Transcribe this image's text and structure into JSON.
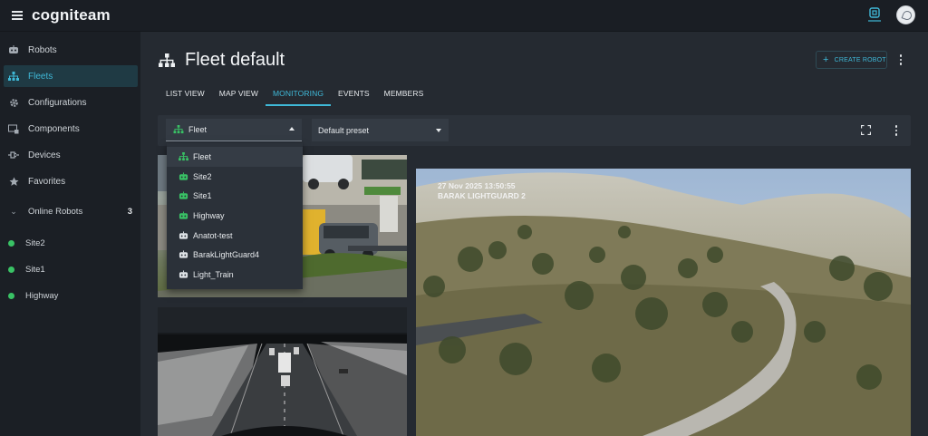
{
  "app": {
    "title": "cogniteam",
    "accent_color": "#3fb9d8",
    "online_color": "#39c265"
  },
  "topbar": {
    "menu_icon": "hamburger-icon",
    "right_icon": "robot-status-icon",
    "avatar_icon": "user-avatar"
  },
  "sidebar": {
    "items": [
      {
        "label": "Robots",
        "icon": "robot-icon"
      },
      {
        "label": "Fleets",
        "icon": "fleet-icon",
        "active": true
      },
      {
        "label": "Configurations",
        "icon": "gear-icon"
      },
      {
        "label": "Components",
        "icon": "components-icon"
      },
      {
        "label": "Devices",
        "icon": "plug-icon"
      },
      {
        "label": "Favorites",
        "icon": "star-icon"
      }
    ],
    "online_header": {
      "label": "Online Robots",
      "count": "3"
    },
    "online_robots": [
      {
        "label": "Site2"
      },
      {
        "label": "Site1"
      },
      {
        "label": "Highway"
      }
    ]
  },
  "page": {
    "title": "Fleet default",
    "create_button": "CREATE ROBOT",
    "tabs": [
      {
        "label": "LIST VIEW"
      },
      {
        "label": "MAP VIEW"
      },
      {
        "label": "MONITORING",
        "active": true
      },
      {
        "label": "EVENTS"
      },
      {
        "label": "MEMBERS"
      }
    ]
  },
  "toolbar": {
    "fleet_select": "Fleet",
    "preset_select": "Default preset"
  },
  "dropdown": {
    "items": [
      {
        "label": "Fleet",
        "icon": "fleet-icon",
        "type": "fleet"
      },
      {
        "label": "Site2",
        "icon": "robot-icon",
        "type": "online"
      },
      {
        "label": "Site1",
        "icon": "robot-icon",
        "type": "online"
      },
      {
        "label": "Highway",
        "icon": "robot-icon",
        "type": "online"
      },
      {
        "label": "Anatot-test",
        "icon": "robot-icon",
        "type": "offline"
      },
      {
        "label": "BarakLightGuard4",
        "icon": "robot-icon",
        "type": "offline"
      },
      {
        "label": "Light_Train",
        "icon": "robot-icon",
        "type": "offline"
      }
    ]
  },
  "cameras": {
    "feed3_overlay_line1": "27 Nov 2025     13:50:55",
    "feed3_overlay_line2": "BARAK LIGHTGUARD 2"
  }
}
